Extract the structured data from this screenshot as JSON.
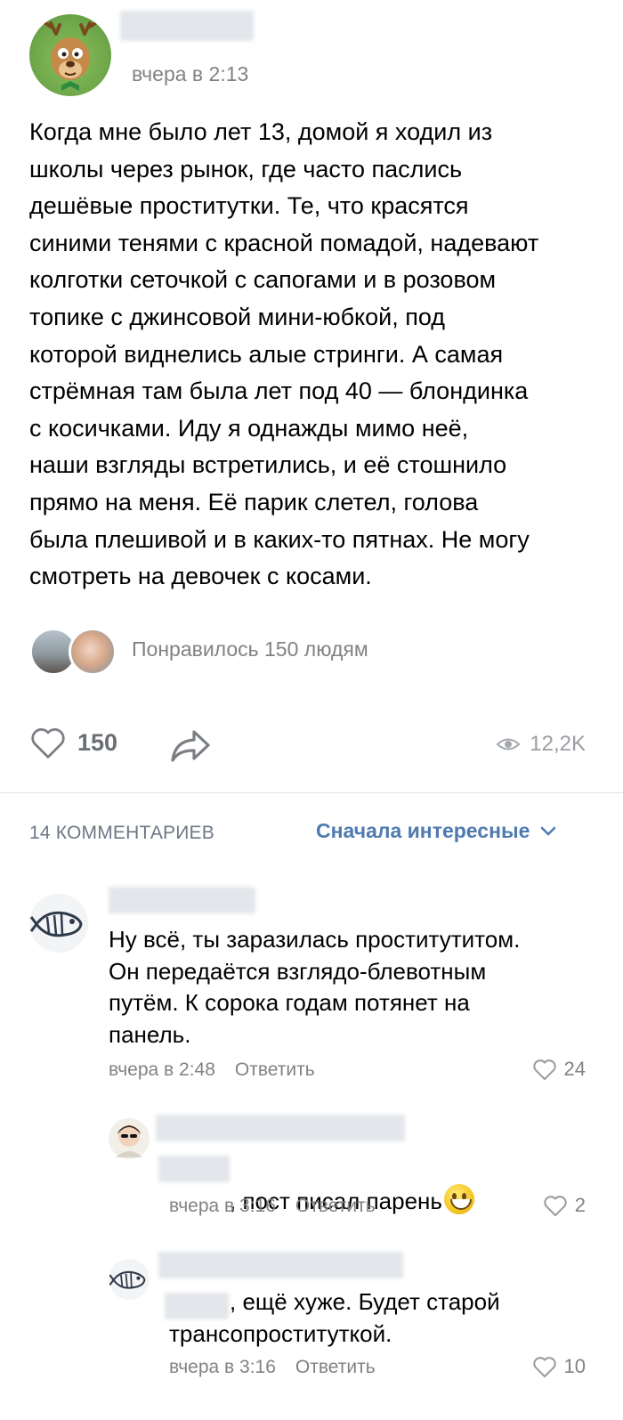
{
  "post": {
    "time": "вчера в 2:13",
    "text": "Когда мне было лет 13, домой я ходил из\nшколы через рынок, где часто паслись\nдешёвые проститутки. Те, что красятся\nсиними тенями с красной помадой, надевают\nколготки сеточкой с сапогами и в розовом\nтопике с джинсовой мини-юбкой, под\nкоторой виднелись алые стринги. А самая\nстрёмная там была лет под 40 — блондинка\nс косичками. Иду я однажды мимо неё,\nнаши взгляды встретились, и её стошнило\nпрямо на меня. Её парик слетел, голова\nбыла плешивой и в каких-то пятнах. Не могу\nсмотреть на девочек с косами.",
    "liked_by": "Понравилось 150 людям",
    "likes": "150",
    "views": "12,2K"
  },
  "comments_header": {
    "count_label": "14 КОММЕНТАРИЕВ",
    "sort_label": "Сначала интересные"
  },
  "comments": [
    {
      "text": "Ну всё, ты заразилась проститутитом.\nОн передаётся взглядо-блевотным\nпутём. К сорока годам потянет на\nпанель.",
      "time": "вчера в 2:48",
      "reply": "Ответить",
      "likes": "24"
    },
    {
      "text": ", пост писал парень",
      "time": "вчера в 3:16",
      "reply": "Ответить",
      "likes": "2"
    },
    {
      "text": ", ещё хуже. Будет старой\nтрансопроституткой.",
      "time": "вчера в 3:16",
      "reply": "Ответить",
      "likes": "10"
    }
  ],
  "colors": {
    "link": "#4e7ab0",
    "meta": "#828282",
    "divider": "#dfe2e6"
  },
  "icons": {
    "like": "heart-outline-icon",
    "share": "share-arrow-icon",
    "views": "eye-icon",
    "sort": "chevron-down-icon"
  }
}
